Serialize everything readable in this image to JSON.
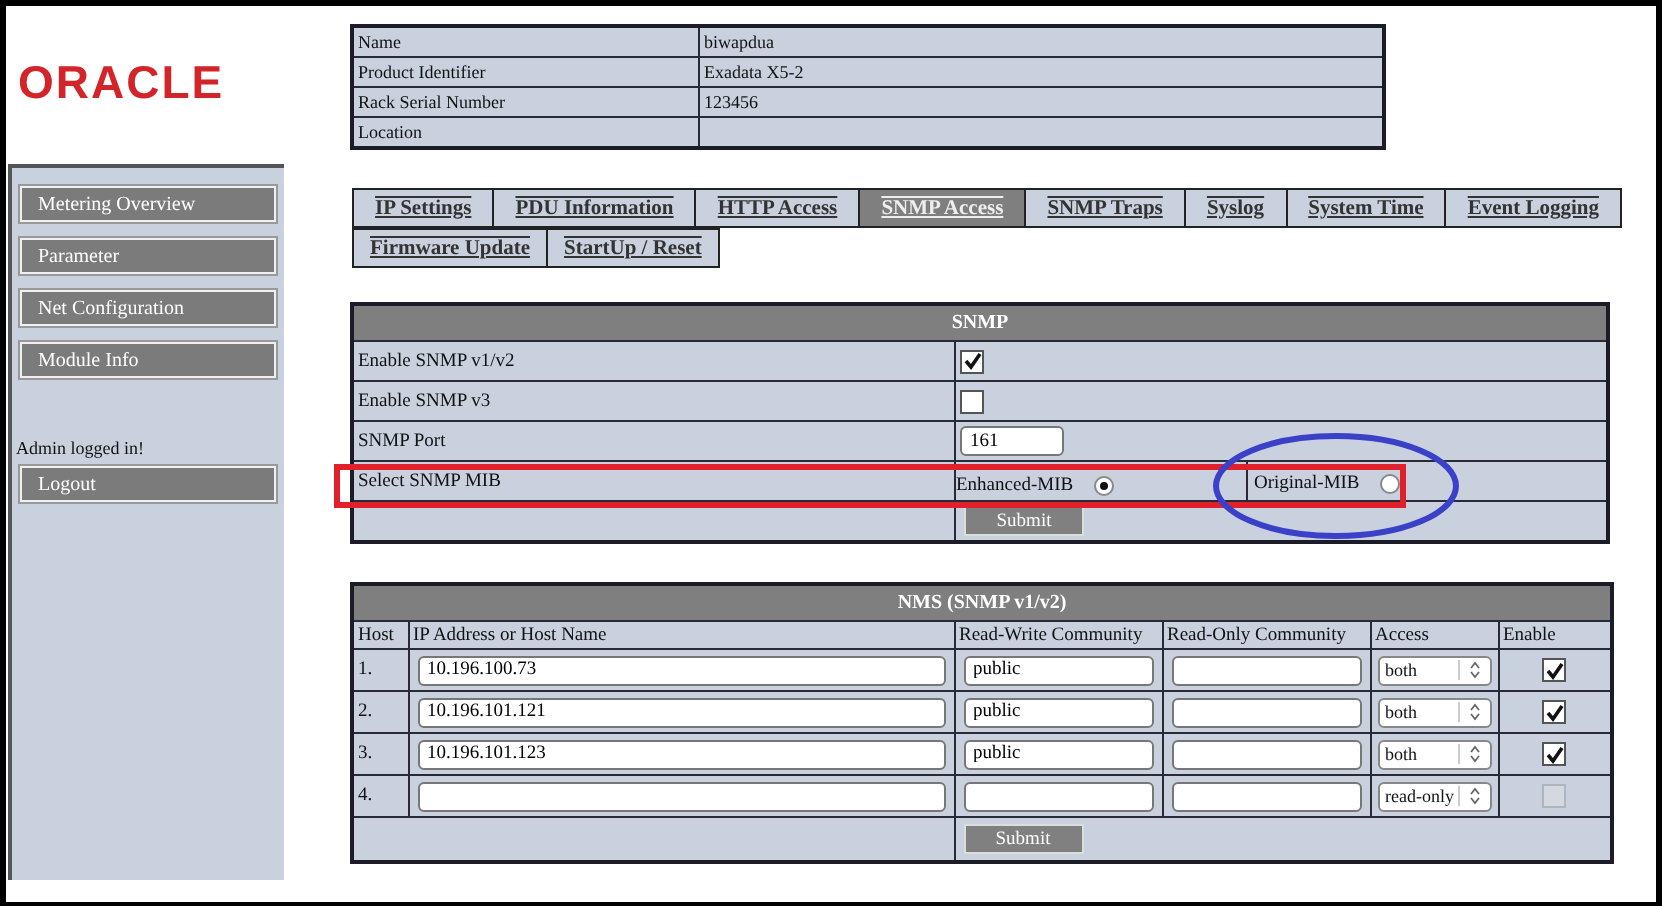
{
  "logo": {
    "text": "ORACLE"
  },
  "sidebar": {
    "items": [
      {
        "label": "Metering Overview"
      },
      {
        "label": "Parameter"
      },
      {
        "label": "Net Configuration"
      },
      {
        "label": "Module Info"
      }
    ],
    "status": "Admin logged in!",
    "logout": "Logout"
  },
  "info": [
    {
      "label": "Name",
      "value": "biwapdua"
    },
    {
      "label": "Product Identifier",
      "value": "Exadata X5-2"
    },
    {
      "label": "Rack Serial Number",
      "value": "123456"
    },
    {
      "label": "Location"
    }
  ],
  "tab_rows": [
    {
      "tabs": [
        {
          "label": "IP Settings",
          "selected": false
        },
        {
          "label": "PDU Information",
          "selected": false
        },
        {
          "label": "HTTP Access",
          "selected": false
        },
        {
          "label": "SNMP Access",
          "selected": true
        },
        {
          "label": "SNMP Traps",
          "selected": false
        },
        {
          "label": "Syslog",
          "selected": false
        },
        {
          "label": "System Time",
          "selected": false
        },
        {
          "label": "Event Logging",
          "selected": false
        }
      ]
    },
    {
      "tabs": [
        {
          "label": "Firmware Update",
          "selected": false
        },
        {
          "label": "StartUp / Reset",
          "selected": false
        }
      ]
    }
  ],
  "snmp": {
    "title": "SNMP",
    "rows": [
      {
        "kind": "checkbox",
        "label": "Enable SNMP v1/v2",
        "checked": true
      },
      {
        "kind": "checkbox",
        "label": "Enable SNMP v3",
        "checked": false
      },
      {
        "kind": "text",
        "label": "SNMP Port",
        "value": "161"
      },
      {
        "kind": "radio",
        "label": "Select SNMP MIB",
        "options": [
          {
            "label": "Enhanced-MIB",
            "selected": true
          },
          {
            "label": "Original-MIB",
            "selected": false
          }
        ]
      }
    ],
    "submit": "Submit"
  },
  "nms": {
    "title": "NMS (SNMP v1/v2)",
    "columns": [
      "Host",
      "IP Address or Host Name",
      "Read-Write Community",
      "Read-Only Community",
      "Access",
      "Enable"
    ],
    "rows": [
      {
        "host": "1.",
        "address": "10.196.100.73",
        "read_write": "public",
        "access": "both",
        "checked": true,
        "disabled": false
      },
      {
        "host": "2.",
        "address": "10.196.101.121",
        "read_write": "public",
        "access": "both",
        "checked": true,
        "disabled": false
      },
      {
        "host": "3.",
        "address": "10.196.101.123",
        "read_write": "public",
        "access": "both",
        "checked": true,
        "disabled": false
      },
      {
        "host": "4.",
        "access": "read-only",
        "checked": false,
        "disabled": true
      }
    ],
    "submit": "Submit"
  },
  "annotations": [
    {
      "kind": "rectangle",
      "color": "#e0202a"
    },
    {
      "kind": "ellipse",
      "color": "#3a40c8"
    }
  ]
}
